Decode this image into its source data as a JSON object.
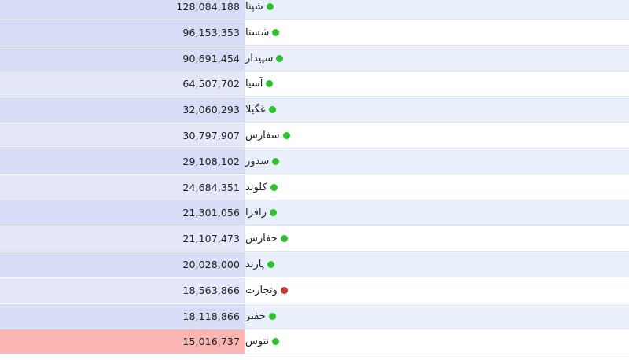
{
  "rows": [
    {
      "name": "شپنا",
      "value": "128,084,188",
      "status": "up",
      "bar_level": 1.0
    },
    {
      "name": "شستا",
      "value": "96,153,353",
      "status": "up",
      "bar_level": 0.75
    },
    {
      "name": "سپیدار",
      "value": "90,691,454",
      "status": "up",
      "bar_level": 0.71
    },
    {
      "name": "آسیا",
      "value": "64,507,702",
      "status": "up",
      "bar_level": 0.5
    },
    {
      "name": "غگیلا",
      "value": "32,060,293",
      "status": "up",
      "bar_level": 0.25
    },
    {
      "name": "سفارس",
      "value": "30,797,907",
      "status": "up",
      "bar_level": 0.24
    },
    {
      "name": "سدور",
      "value": "29,108,102",
      "status": "up",
      "bar_level": 0.23
    },
    {
      "name": "کلوند",
      "value": "24,684,351",
      "status": "up",
      "bar_level": 0.19
    },
    {
      "name": "رافزا",
      "value": "21,301,056",
      "status": "up",
      "bar_level": 0.17
    },
    {
      "name": "حفارس",
      "value": "21,107,473",
      "status": "up",
      "bar_level": 0.16
    },
    {
      "name": "پارند",
      "value": "20,028,000",
      "status": "up",
      "bar_level": 0.16
    },
    {
      "name": "وتجارت",
      "value": "18,563,866",
      "status": "down",
      "bar_level": 0.14
    },
    {
      "name": "خفنر",
      "value": "18,118,866",
      "status": "up",
      "bar_level": 0.14
    },
    {
      "name": "نتوس",
      "value": "15,016,737",
      "status": "highlight",
      "bar_level": 0.12
    }
  ],
  "colors": {
    "status_up": "#2ec12e",
    "status_down": "#c0392b",
    "value_bg_strong": "#d7dcf7",
    "value_bg_light": "#e3e7f8",
    "highlight_bg": "#fbb6b3"
  }
}
